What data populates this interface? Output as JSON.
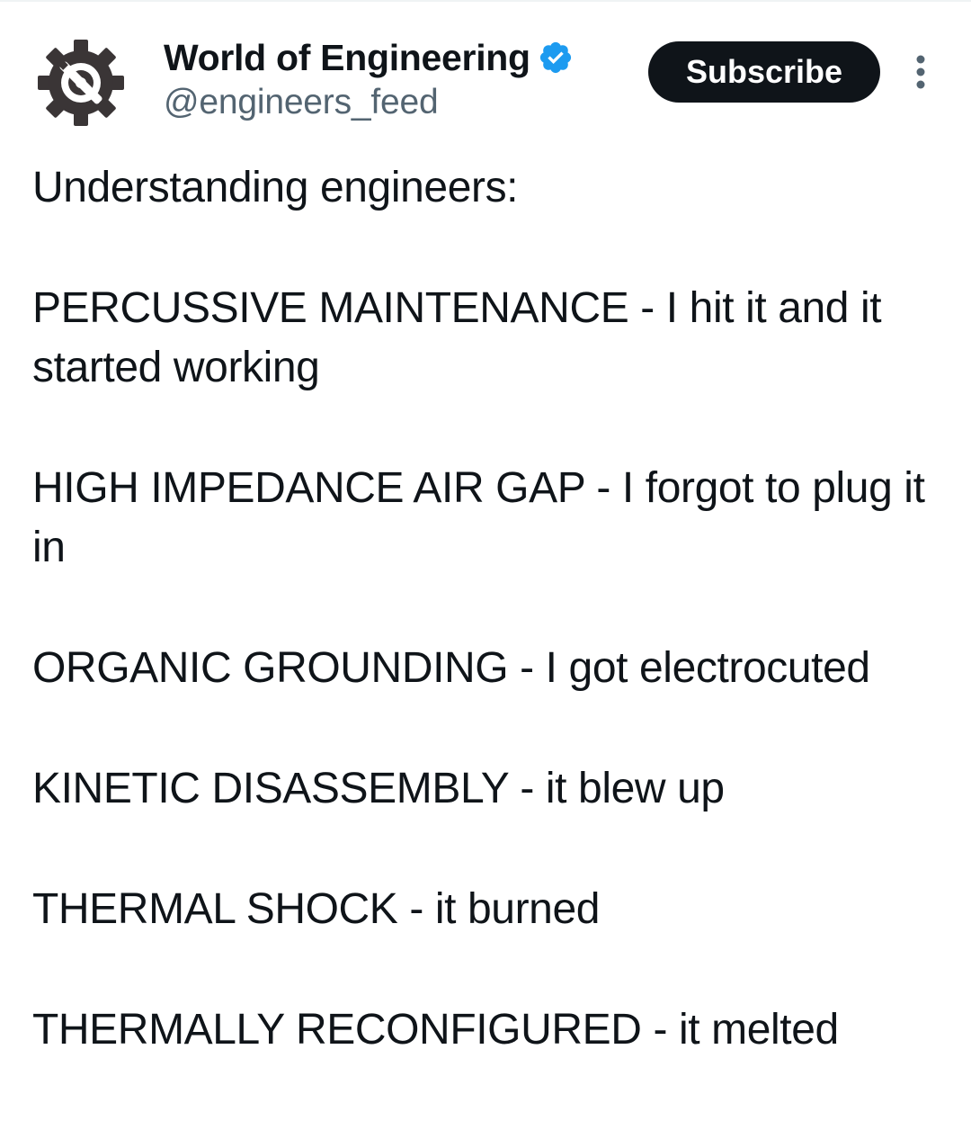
{
  "author": {
    "display_name": "World of Engineering",
    "handle": "@engineers_feed",
    "verified": true,
    "avatar_icon": "gear-wrench-icon",
    "verified_icon": "verified-badge-icon"
  },
  "actions": {
    "subscribe_label": "Subscribe",
    "more_icon": "more-vertical-icon"
  },
  "tweet": {
    "intro": "Understanding engineers:",
    "lines": [
      "PERCUSSIVE MAINTENANCE - I hit it and it started working",
      "HIGH IMPEDANCE AIR GAP - I forgot to plug it in",
      "ORGANIC GROUNDING - I got electrocuted",
      "KINETIC DISASSEMBLY - it blew up",
      "THERMAL SHOCK - it burned",
      "THERMALLY RECONFIGURED - it melted"
    ]
  },
  "colors": {
    "text": "#0f1419",
    "secondary": "#536471",
    "verified_blue": "#1d9bf0",
    "button_bg": "#0f1419",
    "avatar_gear": "#3a3536"
  }
}
